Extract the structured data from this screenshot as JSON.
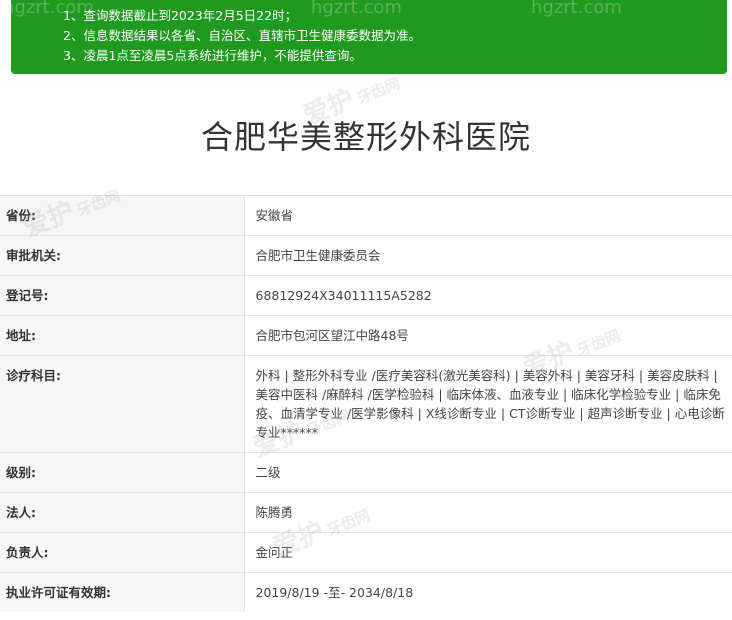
{
  "notice": {
    "lines": [
      "1、查询数据截止到2023年2月5日22时；",
      "2、信息数据结果以各省、自治区、直辖市卫生健康委数据为准。",
      "3、凌晨1点至凌晨5点系统进行维护，不能提供查询。"
    ]
  },
  "page_title": "合肥华美整形外科医院",
  "rows": [
    {
      "label": "省份:",
      "value": "安徽省"
    },
    {
      "label": "审批机关:",
      "value": "合肥市卫生健康委员会"
    },
    {
      "label": "登记号:",
      "value": "68812924X34011115A5282"
    },
    {
      "label": "地址:",
      "value": "合肥市包河区望江中路48号"
    },
    {
      "label": "诊疗科目:",
      "value": "外科 | 整形外科专业 /医疗美容科(激光美容科) | 美容外科 | 美容牙科 | 美容皮肤科 | 美容中医科 /麻醉科 /医学检验科 | 临床体液、血液专业 | 临床化学检验专业 | 临床免疫、血清学专业 /医学影像科 | X线诊断专业 | CT诊断专业 | 超声诊断专业 | 心电诊断专业******"
    },
    {
      "label": "级别:",
      "value": "二级"
    },
    {
      "label": "法人:",
      "value": "陈腾勇"
    },
    {
      "label": "负责人:",
      "value": "金问正"
    },
    {
      "label": "执业许可证有效期:",
      "value": "2019/8/19 -至- 2034/8/18"
    }
  ],
  "watermark": {
    "text": "爱护",
    "sub": "牙齿网",
    "domain": "hgzrt.com"
  },
  "colors": {
    "notice_bg": "#1f9a1f",
    "label_bg": "#f6f6f6",
    "border": "#e3e3e3"
  }
}
